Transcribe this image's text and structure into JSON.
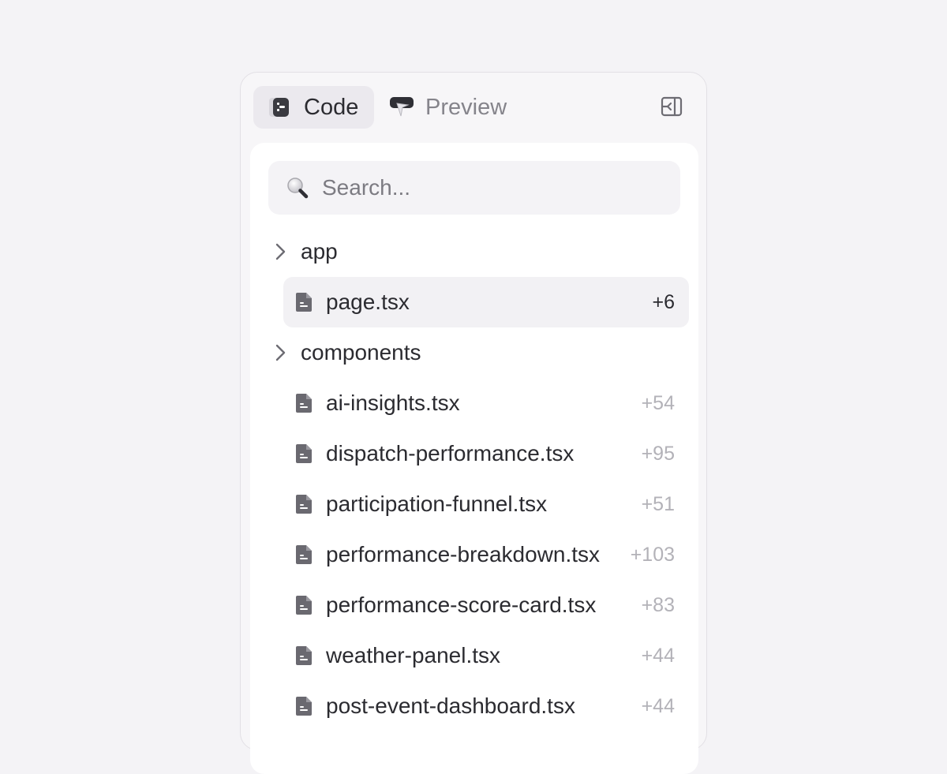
{
  "tabs": {
    "code_label": "Code",
    "preview_label": "Preview"
  },
  "search": {
    "placeholder": "Search..."
  },
  "tree": {
    "folders": [
      {
        "name": "app"
      },
      {
        "name": "components"
      }
    ],
    "app_files": [
      {
        "name": "page.tsx",
        "count": "+6",
        "selected": true
      }
    ],
    "component_files": [
      {
        "name": "ai-insights.tsx",
        "count": "+54"
      },
      {
        "name": "dispatch-performance.tsx",
        "count": "+95"
      },
      {
        "name": "participation-funnel.tsx",
        "count": "+51"
      },
      {
        "name": "performance-breakdown.tsx",
        "count": "+103"
      },
      {
        "name": "performance-score-card.tsx",
        "count": "+83"
      },
      {
        "name": "weather-panel.tsx",
        "count": "+44"
      },
      {
        "name": "post-event-dashboard.tsx",
        "count": "+44"
      }
    ]
  },
  "colors": {
    "background": "#f4f3f6",
    "panel": "#f7f6f8",
    "selected_row": "#f2f1f4",
    "text": "#2b2b30",
    "muted_count": "#b3b2b8"
  }
}
